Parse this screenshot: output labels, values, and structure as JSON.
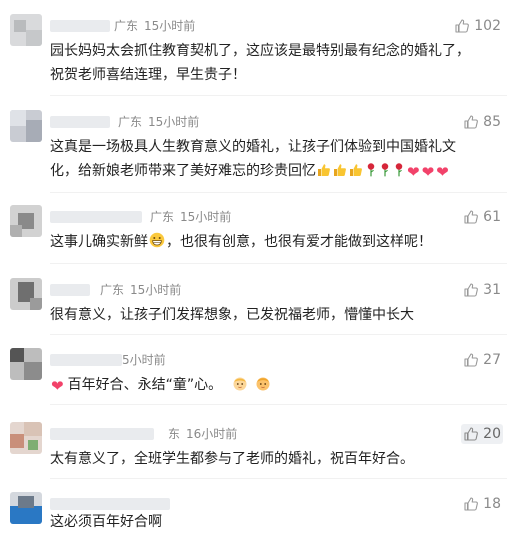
{
  "comments": [
    {
      "location": "广东",
      "time": "15小时前",
      "likes": "102",
      "text_lines": [
        "园长妈妈太会抓住教育契机了，这应该是最特别最有纪念的婚礼了，",
        "祝贺老师喜结连理，早生贵子！"
      ]
    },
    {
      "location": "广东",
      "time": "15小时前",
      "likes": "85",
      "text_lines": [
        "这真是一场极具人生教育意义的婚礼，让孩子们体验到中国婚礼文",
        "化，给新娘老师带来了美好难忘的珍贵回忆"
      ],
      "emojis": [
        "thumbs-up",
        "thumbs-up",
        "thumbs-up",
        "rose",
        "rose",
        "rose",
        "heart",
        "heart",
        "heart"
      ]
    },
    {
      "location": "广东",
      "time": "15小时前",
      "likes": "61",
      "text_before": "这事儿确实新鲜",
      "emoji_mid": "grin-face",
      "text_after": "，也很有创意，也很有爱才能做到这样呢！"
    },
    {
      "location": "广东",
      "time": "15小时前",
      "likes": "31",
      "text_lines": [
        "很有意义，让孩子们发挥想象，已发祝福老师，懵懂中长大"
      ]
    },
    {
      "location": "",
      "time": "5小时前",
      "likes": "27",
      "emoji_lead": "heart",
      "text_lines": [
        "百年好合、永结“童”心。"
      ],
      "emojis_tail": [
        "baby-face",
        "baby-face"
      ]
    },
    {
      "location": "东",
      "time": "16小时前",
      "likes": "20",
      "liked": true,
      "text_lines": [
        "太有意义了，全班学生都参与了老师的婚礼，祝百年好合。"
      ]
    },
    {
      "location": "",
      "time": "",
      "likes": "18",
      "text_lines": [
        "这必须百年好合啊"
      ]
    }
  ],
  "colors": {
    "meta": "#8a8a8a",
    "text": "#222222",
    "heart": "#f2426a",
    "rose": "#d6263a",
    "like_active_bg": "#eef0f3"
  }
}
